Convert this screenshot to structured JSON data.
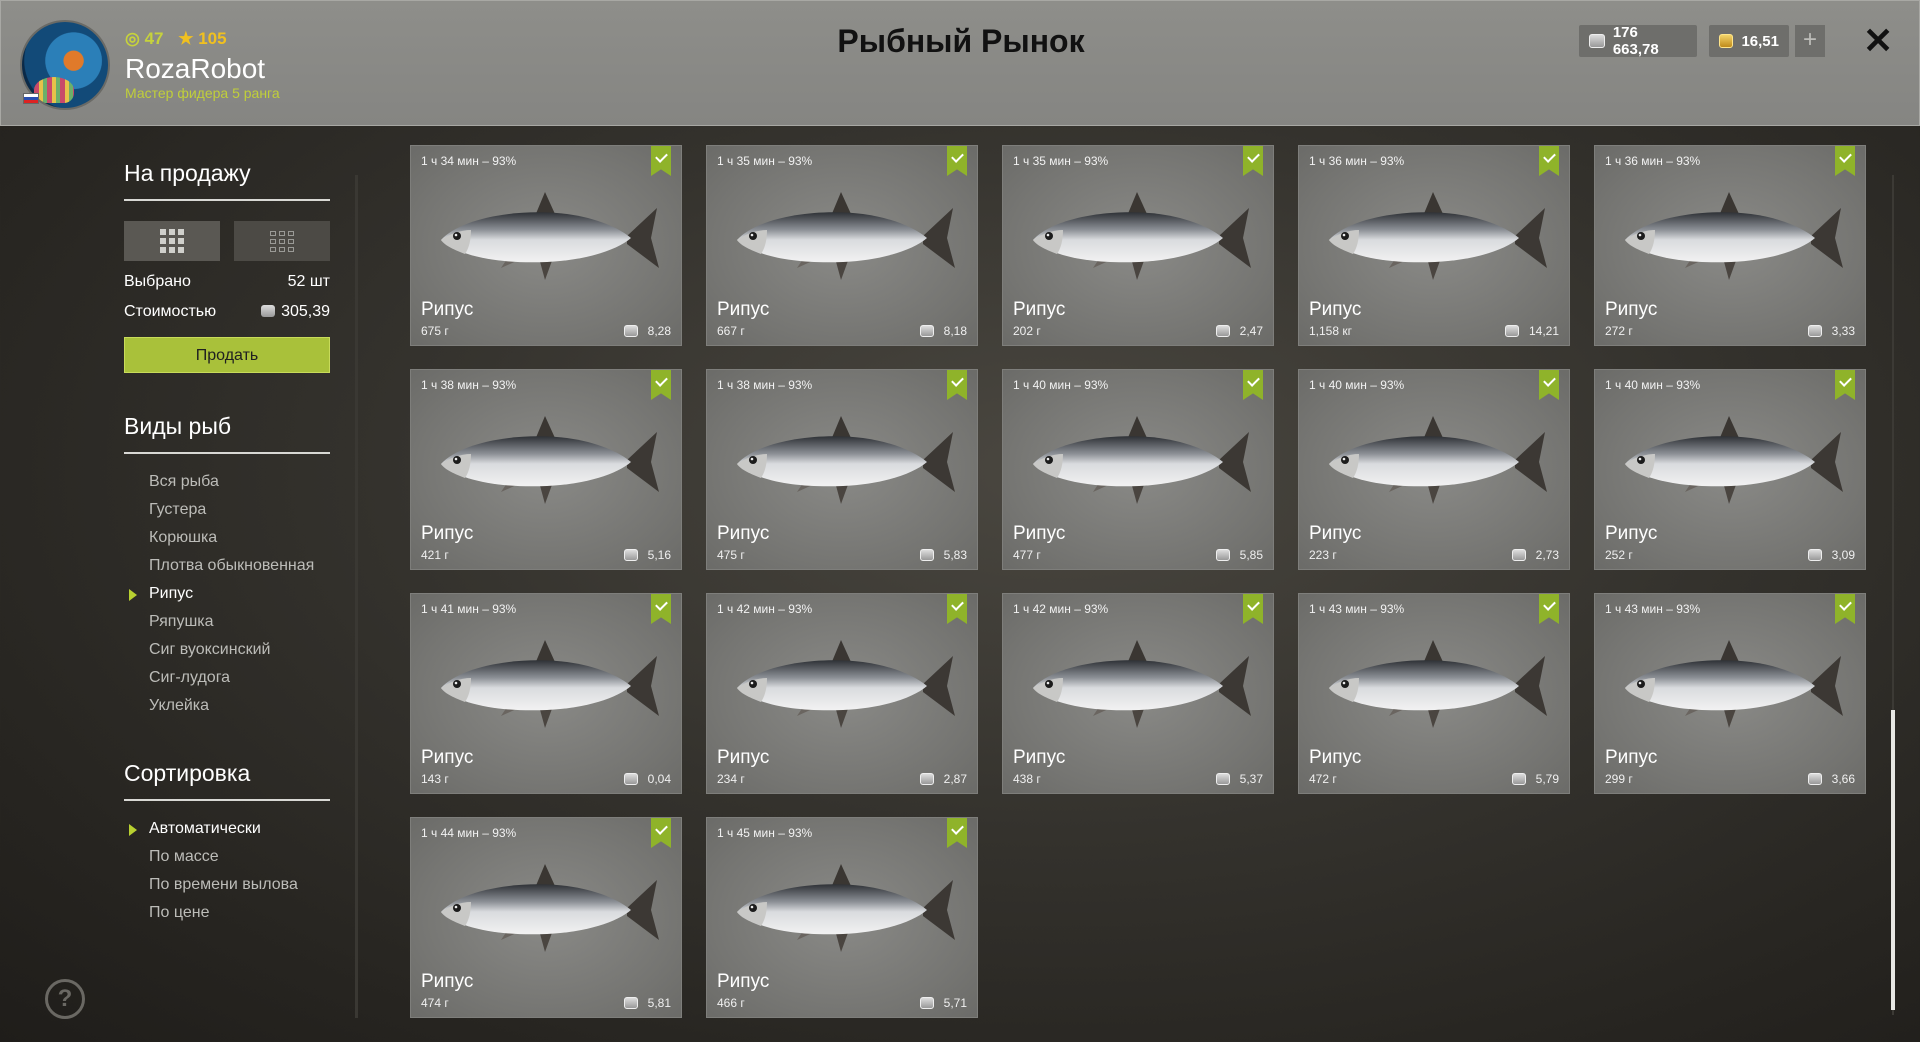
{
  "header": {
    "player": {
      "level": "47",
      "stars": "105",
      "name": "RozaRobot",
      "rank": "Мастер фидера 5 ранга"
    },
    "title": "Рыбный Рынок",
    "silver": "176 663,78",
    "gold": "16,51",
    "plus": "+",
    "close": "✕"
  },
  "sidebar": {
    "sale_title": "На продажу",
    "selected_label": "Выбрано",
    "selected_value": "52 шт",
    "cost_label": "Стоимостью",
    "cost_value": "305,39",
    "sell_button": "Продать",
    "species_title": "Виды рыб",
    "species": [
      {
        "label": "Вся рыба",
        "active": false
      },
      {
        "label": "Густера",
        "active": false
      },
      {
        "label": "Корюшка",
        "active": false
      },
      {
        "label": "Плотва обыкновенная",
        "active": false
      },
      {
        "label": "Рипус",
        "active": true
      },
      {
        "label": "Ряпушка",
        "active": false
      },
      {
        "label": "Сиг вуоксинский",
        "active": false
      },
      {
        "label": "Сиг-лудога",
        "active": false
      },
      {
        "label": "Уклейка",
        "active": false
      }
    ],
    "sort_title": "Сортировка",
    "sort": [
      {
        "label": "Автоматически",
        "active": true
      },
      {
        "label": "По массе",
        "active": false
      },
      {
        "label": "По времени вылова",
        "active": false
      },
      {
        "label": "По цене",
        "active": false
      }
    ],
    "help": "?"
  },
  "fish": [
    {
      "time": "1 ч 34 мин – 93%",
      "name": "Рипус",
      "weight": "675 г",
      "price": "8,28"
    },
    {
      "time": "1 ч 35 мин – 93%",
      "name": "Рипус",
      "weight": "667 г",
      "price": "8,18"
    },
    {
      "time": "1 ч 35 мин – 93%",
      "name": "Рипус",
      "weight": "202 г",
      "price": "2,47"
    },
    {
      "time": "1 ч 36 мин – 93%",
      "name": "Рипус",
      "weight": "1,158 кг",
      "price": "14,21"
    },
    {
      "time": "1 ч 36 мин – 93%",
      "name": "Рипус",
      "weight": "272 г",
      "price": "3,33"
    },
    {
      "time": "1 ч 38 мин – 93%",
      "name": "Рипус",
      "weight": "421 г",
      "price": "5,16"
    },
    {
      "time": "1 ч 38 мин – 93%",
      "name": "Рипус",
      "weight": "475 г",
      "price": "5,83"
    },
    {
      "time": "1 ч 40 мин – 93%",
      "name": "Рипус",
      "weight": "477 г",
      "price": "5,85"
    },
    {
      "time": "1 ч 40 мин – 93%",
      "name": "Рипус",
      "weight": "223 г",
      "price": "2,73"
    },
    {
      "time": "1 ч 40 мин – 93%",
      "name": "Рипус",
      "weight": "252 г",
      "price": "3,09"
    },
    {
      "time": "1 ч 41 мин – 93%",
      "name": "Рипус",
      "weight": "143 г",
      "price": "0,04"
    },
    {
      "time": "1 ч 42 мин – 93%",
      "name": "Рипус",
      "weight": "234 г",
      "price": "2,87"
    },
    {
      "time": "1 ч 42 мин – 93%",
      "name": "Рипус",
      "weight": "438 г",
      "price": "5,37"
    },
    {
      "time": "1 ч 43 мин – 93%",
      "name": "Рипус",
      "weight": "472 г",
      "price": "5,79"
    },
    {
      "time": "1 ч 43 мин – 93%",
      "name": "Рипус",
      "weight": "299 г",
      "price": "3,66"
    },
    {
      "time": "1 ч 44 мин – 93%",
      "name": "Рипус",
      "weight": "474 г",
      "price": "5,81"
    },
    {
      "time": "1 ч 45 мин – 93%",
      "name": "Рипус",
      "weight": "466 г",
      "price": "5,71"
    }
  ],
  "colors": {
    "accent": "#a9c13a",
    "ribbon": "#8fb32a",
    "header_bg": "#8a8a87"
  }
}
